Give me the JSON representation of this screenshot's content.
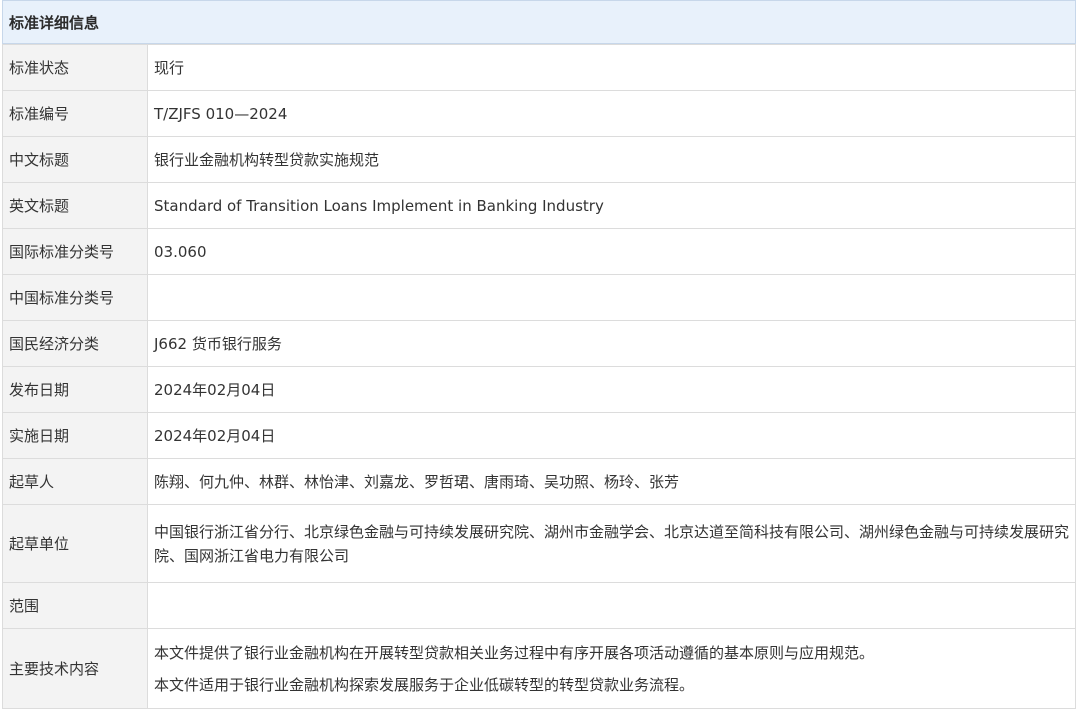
{
  "header": {
    "title": "标准详细信息"
  },
  "rows": [
    {
      "label": "标准状态",
      "value": "现行"
    },
    {
      "label": "标准编号",
      "value": "T/ZJFS 010—2024"
    },
    {
      "label": "中文标题",
      "value": "银行业金融机构转型贷款实施规范"
    },
    {
      "label": "英文标题",
      "value": "Standard of Transition Loans Implement in Banking Industry"
    },
    {
      "label": "国际标准分类号",
      "value": "03.060"
    },
    {
      "label": "中国标准分类号",
      "value": ""
    },
    {
      "label": "国民经济分类",
      "value": "J662 货币银行服务"
    },
    {
      "label": "发布日期",
      "value": "2024年02月04日"
    },
    {
      "label": "实施日期",
      "value": "2024年02月04日"
    },
    {
      "label": "起草人",
      "value": "陈翔、何九仲、林群、林怡津、刘嘉龙、罗哲珺、唐雨琦、吴功照、杨玲、张芳"
    },
    {
      "label": "起草单位",
      "value": "中国银行浙江省分行、北京绿色金融与可持续发展研究院、湖州市金融学会、北京达道至简科技有限公司、湖州绿色金融与可持续发展研究院、国网浙江省电力有限公司"
    },
    {
      "label": "范围",
      "value": ""
    },
    {
      "label": "主要技术内容",
      "value_lines": [
        "本文件提供了银行业金融机构在开展转型贷款相关业务过程中有序开展各项活动遵循的基本原则与应用规范。",
        "本文件适用于银行业金融机构探索发展服务于企业低碳转型的转型贷款业务流程。"
      ]
    }
  ]
}
